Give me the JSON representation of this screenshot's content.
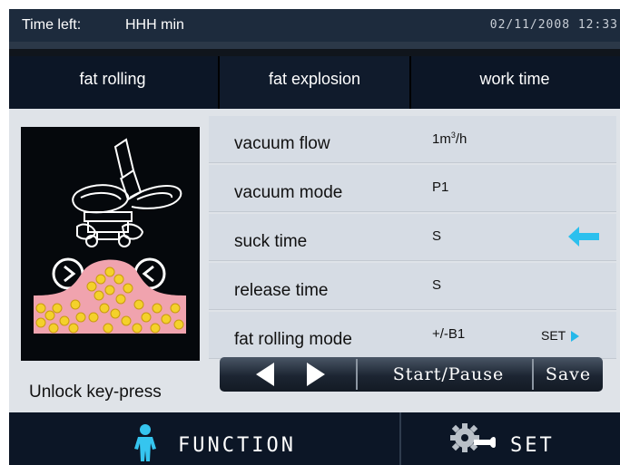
{
  "status": {
    "time_left_label": "Time left:",
    "time_left_value": "HHH min",
    "datetime": "02/11/2008  12:33"
  },
  "tabs": [
    {
      "label": "fat rolling",
      "active": true
    },
    {
      "label": "fat explosion",
      "active": false
    },
    {
      "label": "work time",
      "active": false
    }
  ],
  "params": [
    {
      "name": "vacuum flow",
      "value": "1m",
      "unit_sup": "3",
      "unit_after": "/h"
    },
    {
      "name": "vacuum mode",
      "value": "P1"
    },
    {
      "name": "suck time",
      "value": "S",
      "selected": true
    },
    {
      "name": "release time",
      "value": "S"
    },
    {
      "name": "fat rolling mode",
      "value": "+/-B1",
      "link": "SET"
    }
  ],
  "controls": {
    "start_pause": "Start/Pause",
    "save": "Save"
  },
  "unlock_label": "Unlock key-press",
  "bottom": {
    "function_label": "FUNCTION",
    "set_label": "SET"
  },
  "icons": {
    "selected_row": "arrow-left-icon",
    "prev": "triangle-left-icon",
    "next": "triangle-right-icon",
    "function": "person-icon",
    "set": "gear-wrench-icon"
  },
  "colors": {
    "accent": "#2cc0ee",
    "bar_dark": "#0c1626",
    "panel": "#d6dce4"
  }
}
